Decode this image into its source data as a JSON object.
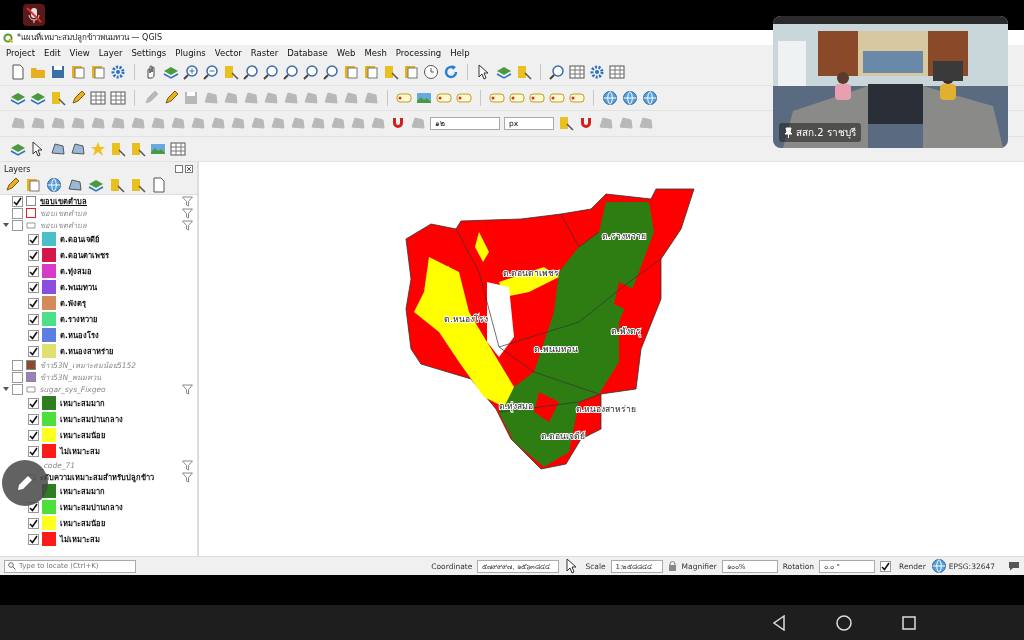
{
  "window": {
    "title": "*แผนที่เหมาะสมปลูกข้าวพนมทวน — QGIS"
  },
  "menu": [
    "Project",
    "Edit",
    "View",
    "Layer",
    "Settings",
    "Plugins",
    "Vector",
    "Raster",
    "Database",
    "Web",
    "Mesh",
    "Processing",
    "Help"
  ],
  "snapping": {
    "tolerance": "๑๒",
    "unit": "px"
  },
  "layers_panel": {
    "title": "Layers",
    "layers": [
      {
        "name": "ขอบเขตตำบล",
        "checked": true,
        "kind": "active",
        "color": "#ffffff",
        "filter": true
      },
      {
        "name": "ขอบเขตตำบล",
        "checked": false,
        "kind": "outline",
        "color": "#e0202a",
        "filter": true
      },
      {
        "name": "ขอบเขตตำบล",
        "checked": false,
        "kind": "hidden",
        "filter": true,
        "expanded": true,
        "children": [
          {
            "name": "ต.ดอนเจดีย์",
            "checked": true,
            "color": "#4bbfc8"
          },
          {
            "name": "ต.ดอนตาเพชร",
            "checked": true,
            "color": "#d4174a"
          },
          {
            "name": "ต.ทุ่งสมอ",
            "checked": true,
            "color": "#d63cc8"
          },
          {
            "name": "ต.พนมทวน",
            "checked": true,
            "color": "#8b4fe0"
          },
          {
            "name": "ต.พังตรุ",
            "checked": true,
            "color": "#d48a5a"
          },
          {
            "name": "ต.รางหวาย",
            "checked": true,
            "color": "#4de08a"
          },
          {
            "name": "ต.หนองโรง",
            "checked": true,
            "color": "#5a7fe0"
          },
          {
            "name": "ต.หนองสาหร่าย",
            "checked": true,
            "color": "#e0e070"
          }
        ]
      },
      {
        "name": "ข้าว53N_เหมาะสมน้อย5152",
        "checked": false,
        "kind": "hidden",
        "color": "#8b4a2b",
        "filter": false
      },
      {
        "name": "ข้าว53N_พนมทวน",
        "checked": false,
        "kind": "hidden",
        "color": "#9b7fc0",
        "filter": false
      },
      {
        "name": "sugar_sys_Fixgeo",
        "checked": false,
        "kind": "hidden",
        "filter": true,
        "expanded": true,
        "children": [
          {
            "name": "เหมาะสมมาก",
            "checked": true,
            "color": "#2e7d1e"
          },
          {
            "name": "เหมาะสมปานกลาง",
            "checked": true,
            "color": "#4ee03a"
          },
          {
            "name": "เหมาะสมน้อย",
            "checked": true,
            "color": "#ffff20"
          },
          {
            "name": "ไม่เหมาะสม",
            "checked": true,
            "color": "#ff1a1a"
          }
        ]
      },
      {
        "name": "_code_71",
        "kind": "hidden",
        "filter": true
      },
      {
        "name": "ะดับความเหมาะสมสำหรับปลูกข้าว",
        "kind": "group",
        "filter": true,
        "children": [
          {
            "name": "เหมาะสมมาก",
            "color": "#2e7d1e"
          },
          {
            "name": "เหมาะสมปานกลาง",
            "checked": true,
            "color": "#4ee03a"
          },
          {
            "name": "เหมาะสมน้อย",
            "checked": true,
            "color": "#ffff20"
          },
          {
            "name": "ไม่เหมาะสม",
            "checked": true,
            "color": "#ff1a1a"
          }
        ]
      }
    ]
  },
  "map": {
    "labels": [
      "ต.รางหวาย",
      "ต.ดอนตาเพชร",
      "ต.หนองโรง",
      "ต.พังตรุ",
      "ต.พนมทวน",
      "ต.ทุ่งสมอ",
      "ต.หนองสาหร่าย",
      "ต.ดอนเจดีย์"
    ]
  },
  "status_bar": {
    "locate": {
      "placeholder": "Type to locate (Ctrl+K)"
    },
    "coordinate": {
      "label": "Coordinate",
      "value": "๕๗๙๙๙๗, ๑๕๖๓๘๔๔"
    },
    "scale": {
      "label": "Scale",
      "value": "1:๒๕๘๘๔๔"
    },
    "magnifier": {
      "label": "Magnifier",
      "value": "๑๐๐%"
    },
    "rotation": {
      "label": "Rotation",
      "value": "๐.๐ °"
    },
    "render": {
      "label": "Render",
      "checked": true
    },
    "crs": "EPSG:32647"
  },
  "video": {
    "caption": "สสก.2 ราชบุรี"
  }
}
